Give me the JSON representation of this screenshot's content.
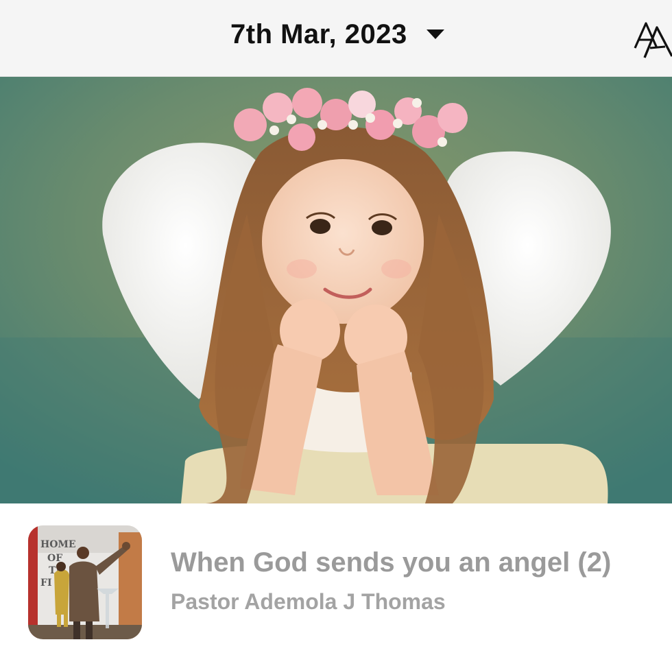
{
  "header": {
    "date": "7th Mar, 2023",
    "date_dropdown_icon": "triangle-down-icon",
    "font_size_icon": "text-size-icon"
  },
  "hero": {
    "image": "girl with angel wings and flower crown"
  },
  "devotional": {
    "title": "When God sends you an angel (2)",
    "author": "Pastor Ademola J Thomas",
    "thumbnail": {
      "sign_text": "HOME OF THE FI"
    }
  },
  "colors": {
    "header_bg": "#f5f5f5",
    "title_text": "#9a9a9a",
    "author_text": "#a3a3a3"
  }
}
